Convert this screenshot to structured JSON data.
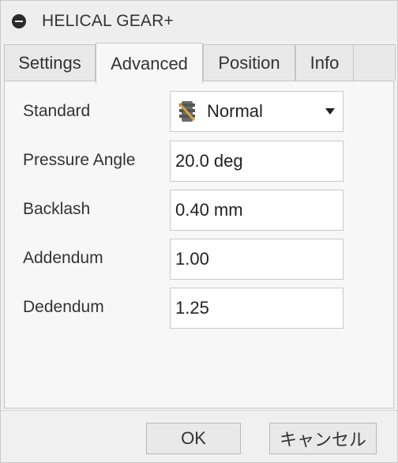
{
  "window": {
    "title": "HELICAL GEAR+"
  },
  "tabs": [
    {
      "label": "Settings"
    },
    {
      "label": "Advanced"
    },
    {
      "label": "Position"
    },
    {
      "label": "Info"
    }
  ],
  "form": {
    "standard": {
      "label": "Standard",
      "value": "Normal",
      "icon": "gear-icon"
    },
    "pressure_angle": {
      "label": "Pressure Angle",
      "value": "20.0 deg"
    },
    "backlash": {
      "label": "Backlash",
      "value": "0.40 mm"
    },
    "addendum": {
      "label": "Addendum",
      "value": "1.00"
    },
    "dedendum": {
      "label": "Dedendum",
      "value": "1.25"
    }
  },
  "buttons": {
    "ok": "OK",
    "cancel": "キャンセル"
  }
}
